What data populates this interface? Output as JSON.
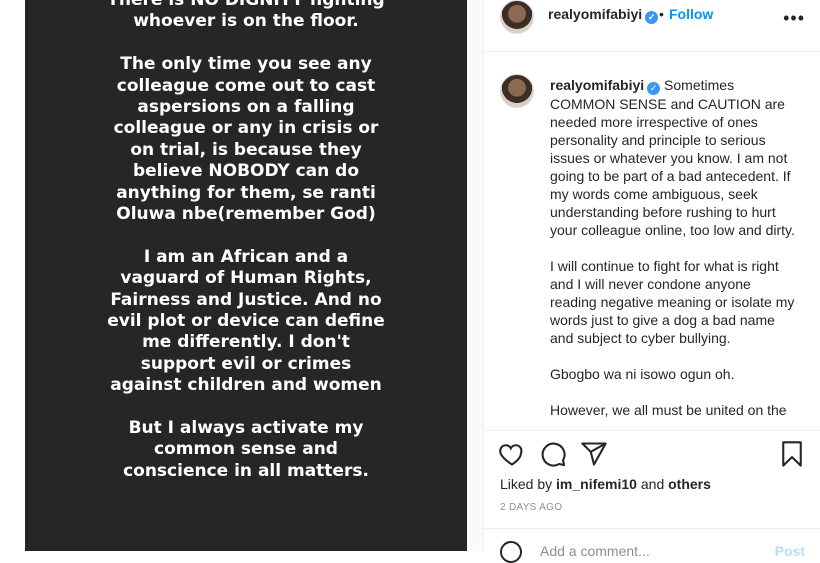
{
  "story": {
    "paragraphs": [
      "There is NO DIGNITY fighting whoever is on the floor.",
      "The only time you see any colleague come out to cast aspersions on a falling colleague or any in crisis or on trial, is because they believe NOBODY can do anything for them, se ranti Oluwa nbe(remember God)",
      "I am an African and a vaguard of Human Rights, Fairness and Justice. And no evil plot or device can define me differently. I don't support evil or crimes against children and women",
      "But I always activate my common sense and conscience in all matters."
    ]
  },
  "header": {
    "username": "realyomifabiyi",
    "dot": "•",
    "follow_label": "Follow",
    "more_icon": "more-options-icon"
  },
  "caption": {
    "username": "realyomifabiyi",
    "paragraphs": [
      "Sometimes COMMON SENSE and CAUTION are needed more irrespective of ones personality and principle to serious issues or whatever you know. I am not going to be part of a bad antecedent. If my words come ambiguous, seek understanding before rushing to hurt your colleague online, too low and dirty.",
      "I will continue to fight for what is right and I will never condone anyone reading negative meaning or isolate my words just to give a dog a bad name and subject to cyber bullying.",
      "Gbogbo wa ni isowo ogun oh.",
      "However, we all must be united on the"
    ]
  },
  "actions": {
    "like_icon": "heart-icon",
    "comment_icon": "comment-icon",
    "share_icon": "share-icon",
    "save_icon": "bookmark-icon"
  },
  "likes": {
    "prefix": "Liked by ",
    "user": "im_nifemi10",
    "middle": " and ",
    "others": "others"
  },
  "date": "2 DAYS AGO",
  "comment_bar": {
    "placeholder": "Add a comment...",
    "post_label": "Post"
  },
  "colors": {
    "story_bg": "#262626",
    "link_blue": "#0095f6",
    "verified_blue": "#3897f0"
  }
}
